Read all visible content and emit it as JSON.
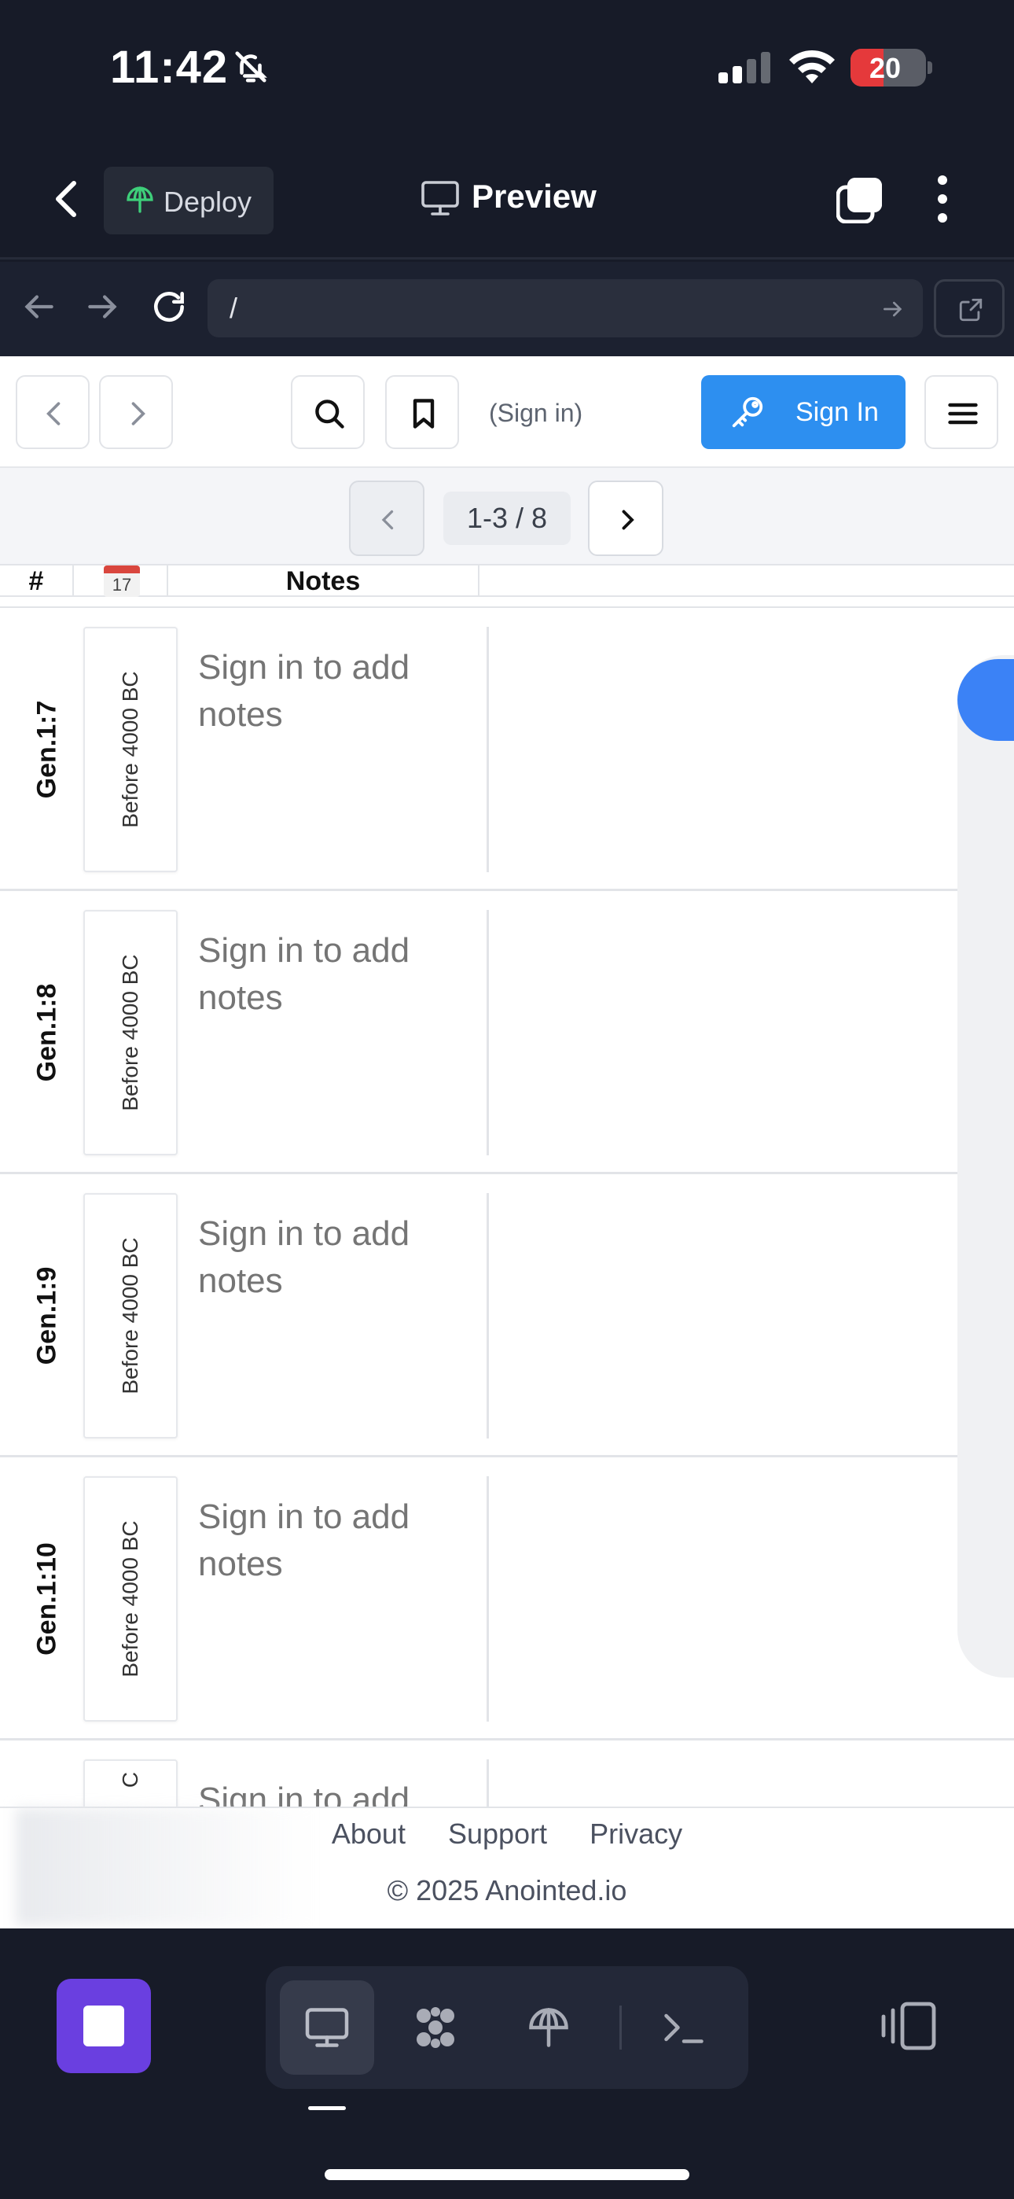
{
  "status": {
    "time": "11:42",
    "battery": "20"
  },
  "app_header": {
    "deploy_label": "Deploy",
    "preview_label": "Preview"
  },
  "url": {
    "value": "/"
  },
  "site_header": {
    "signin_hint": "(Sign in)",
    "signin_button": "Sign In"
  },
  "pager": {
    "range": "1-3 / 8"
  },
  "table": {
    "headers": {
      "num": "#",
      "cal_day": "17",
      "notes": "Notes"
    },
    "rows": [
      {
        "ref": "Gen.1:7",
        "date": "Before 4000 BC",
        "notes": "Sign in to add notes"
      },
      {
        "ref": "Gen.1:8",
        "date": "Before 4000 BC",
        "notes": "Sign in to add notes"
      },
      {
        "ref": "Gen.1:9",
        "date": "Before 4000 BC",
        "notes": "Sign in to add notes"
      },
      {
        "ref": "Gen.1:10",
        "date": "Before 4000 BC",
        "notes": "Sign in to add notes"
      },
      {
        "ref": "",
        "date": "C",
        "notes": "Sign in to add"
      }
    ]
  },
  "footer": {
    "links": [
      "About",
      "Support",
      "Privacy"
    ],
    "copyright": "© 2025 Anointed.io"
  },
  "colors": {
    "primary": "#2d8ff0",
    "stop_button": "#6a3fe0",
    "app_bg": "#171b28",
    "scroll_thumb": "#3b82f6"
  }
}
